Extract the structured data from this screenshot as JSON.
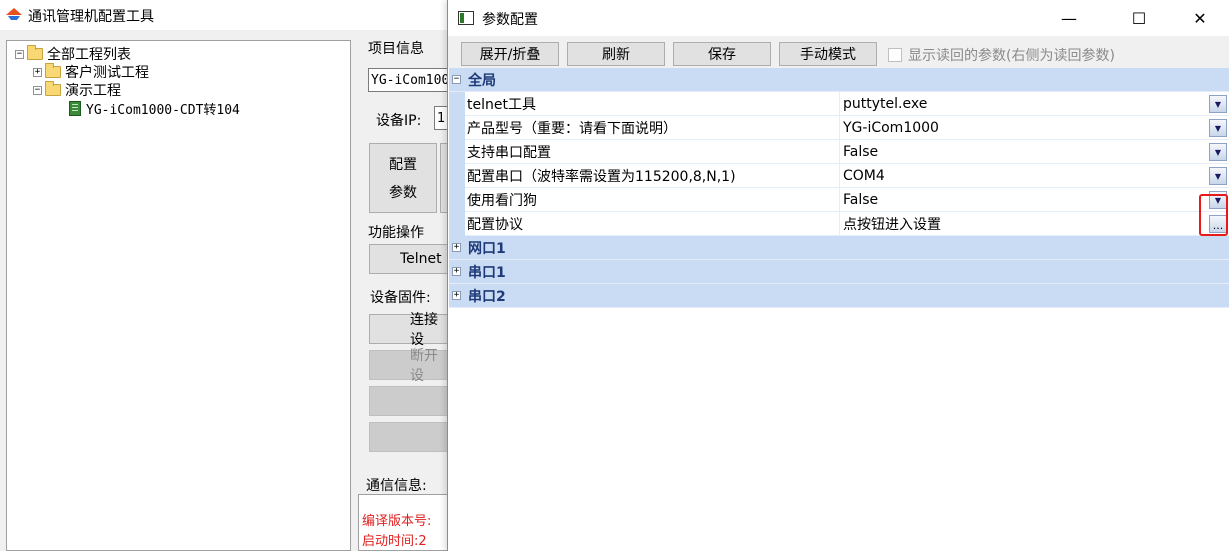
{
  "main": {
    "title": "通讯管理机配置工具",
    "tree": {
      "root": "全部工程列表",
      "children": [
        {
          "label": "客户测试工程"
        },
        {
          "label": "演示工程",
          "children": [
            {
              "label": "YG-iCom1000-CDT转104"
            }
          ]
        }
      ]
    },
    "project_info": {
      "group_label": "项目信息",
      "project_field_value": "YG-iCom100",
      "device_ip_label": "设备IP:",
      "device_ip_value": "1",
      "config_button_line1": "配置",
      "config_button_line2": "参数"
    },
    "functions": {
      "group_label": "功能操作",
      "telnet_button": "Telnet",
      "firmware_label": "设备固件:",
      "connect_button": "连接设",
      "disconnect_button": "断开设"
    },
    "comm": {
      "label": "通信信息:",
      "log_lines": [
        "编译版本号:",
        "启动时间:2"
      ]
    }
  },
  "dialog": {
    "title": "参数配置",
    "controls": {
      "minimize": "—",
      "maximize": "☐",
      "close": "✕"
    },
    "toolbar": {
      "expand_collapse": "展开/折叠",
      "refresh": "刷新",
      "save": "保存",
      "manual_mode": "手动模式",
      "show_read_params": "显示读回的参数(右侧为读回参数)"
    },
    "grid": {
      "categories": [
        {
          "label": "全局",
          "expanded": true
        },
        {
          "label": "网口1",
          "expanded": false
        },
        {
          "label": "串口1",
          "expanded": false
        },
        {
          "label": "串口2",
          "expanded": false
        }
      ],
      "global_props": [
        {
          "name": "telnet工具",
          "value": "puttytel.exe",
          "editor": "dropdown"
        },
        {
          "name": "产品型号（重要：请看下面说明）",
          "value": "YG-iCom1000",
          "editor": "dropdown"
        },
        {
          "name": "支持串口配置",
          "value": "False",
          "editor": "dropdown"
        },
        {
          "name": "配置串口（波特率需设置为115200,8,N,1)",
          "value": "COM4",
          "editor": "dropdown"
        },
        {
          "name": "使用看门狗",
          "value": "False",
          "editor": "dropdown"
        },
        {
          "name": "配置协议",
          "value": "点按钮进入设置",
          "editor": "ellipsis"
        }
      ],
      "ellipsis_glyph": "...",
      "dropdown_glyph": "▼",
      "expanded_glyph": "−",
      "collapsed_glyph": "+"
    },
    "highlight_color": "#e81919"
  }
}
